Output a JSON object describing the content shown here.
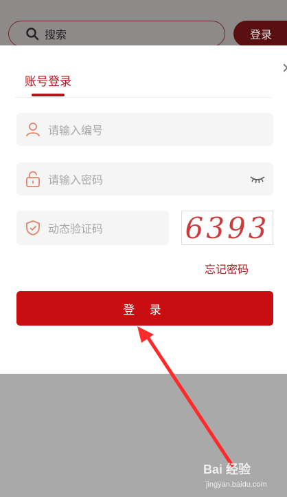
{
  "background": {
    "search_placeholder": "搜索",
    "login_button": "登录"
  },
  "modal": {
    "tab_label": "账号登录",
    "close_glyph": "×",
    "fields": {
      "account_placeholder": "请输入编号",
      "password_placeholder": "请输入密码",
      "captcha_placeholder": "动态验证码"
    },
    "captcha_value": "6393",
    "forgot_password": "忘记密码",
    "login_button": "登 录"
  },
  "watermark": {
    "line1": "Bai 经验",
    "line2": "jingyan.baidu.com"
  },
  "colors": {
    "accent": "#c90e12",
    "accent_text": "#b2141b",
    "arrow": "#ff2a2a"
  },
  "icons": [
    "search-icon",
    "user-icon",
    "lock-icon",
    "shield-icon",
    "eye-closed-icon",
    "close-icon"
  ]
}
